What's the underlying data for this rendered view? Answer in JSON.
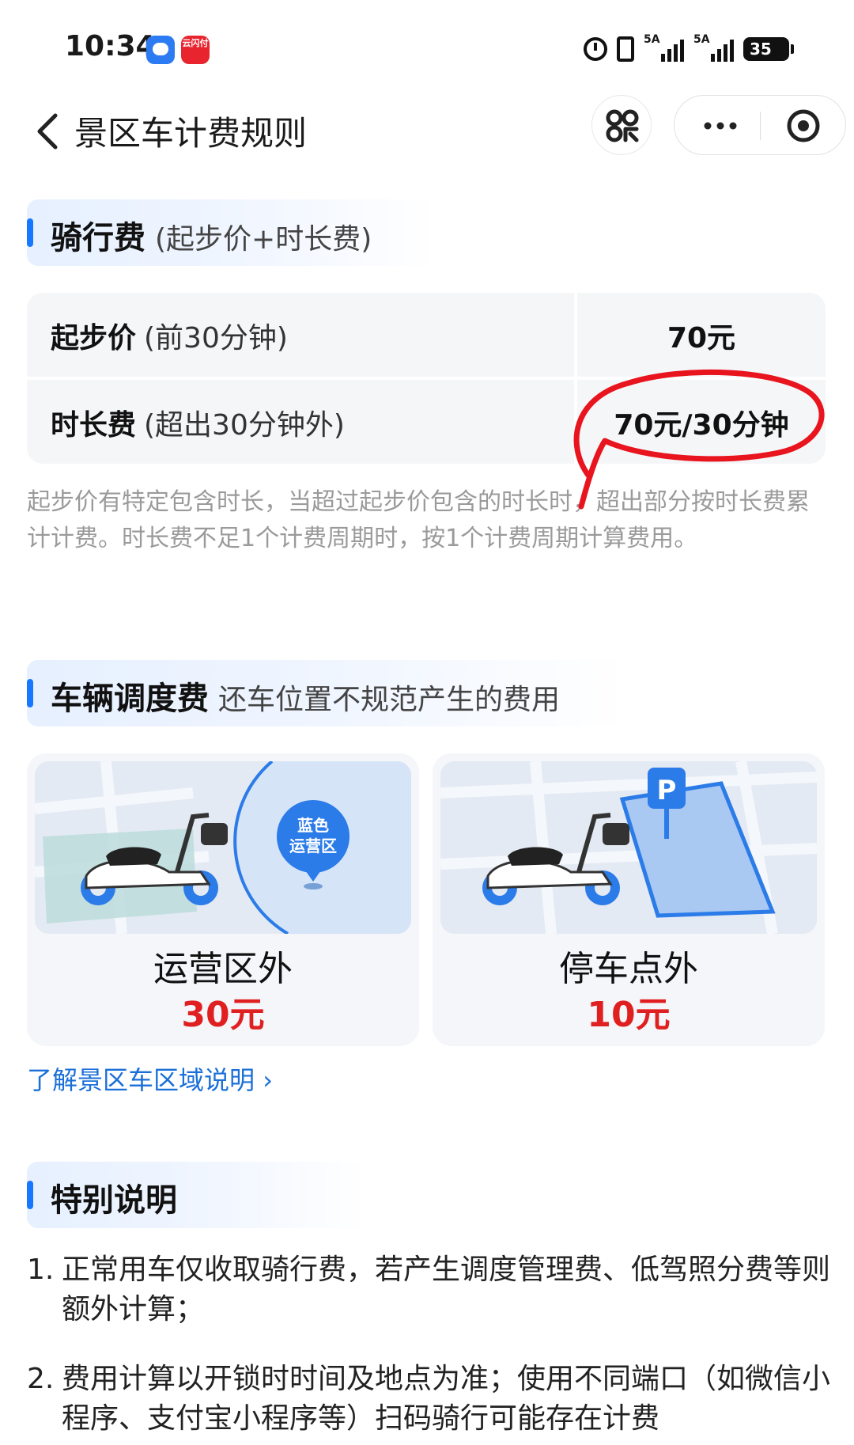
{
  "status_bar": {
    "time": "10:34",
    "pay_app_label": "云闪付",
    "signal_1_label": "5A",
    "signal_2_label": "5A",
    "battery": "35"
  },
  "header": {
    "title": "景区车计费规则"
  },
  "riding_fee": {
    "title": "骑行费",
    "subtitle": "(起步价+时长费)",
    "rows": [
      {
        "name": "起步价",
        "note": "(前30分钟)",
        "price": "70元"
      },
      {
        "name": "时长费",
        "note": "(超出30分钟外)",
        "price": "70元/30分钟"
      }
    ],
    "description": "起步价有特定包含时长，当超过起步价包含的时长时，超出部分按时长费累计计费。时长费不足1个计费周期时，按1个计费周期计算费用。"
  },
  "dispatch_fee": {
    "title": "车辆调度费",
    "subtitle": "还车位置不规范产生的费用",
    "cards": [
      {
        "label": "运营区外",
        "price": "30元",
        "pin_line1": "蓝色",
        "pin_line2": "运营区"
      },
      {
        "label": "停车点外",
        "price": "10元",
        "sign": "P"
      }
    ],
    "link": "了解景区车区域说明"
  },
  "special": {
    "title": "特别说明",
    "items": [
      {
        "num": "1.",
        "text": "正常用车仅收取骑行费，若产生调度管理费、低驾照分费等则额外计算；"
      },
      {
        "num": "2.",
        "text": "费用计算以开锁时时间及地点为准；使用不同端口（如微信小程序、支付宝小程序等）扫码骑行可能存在计费"
      }
    ]
  },
  "colors": {
    "accent": "#1677ff",
    "price_red": "#e02020",
    "annotation_red": "#e8141e",
    "link_blue": "#1a6fd8"
  }
}
